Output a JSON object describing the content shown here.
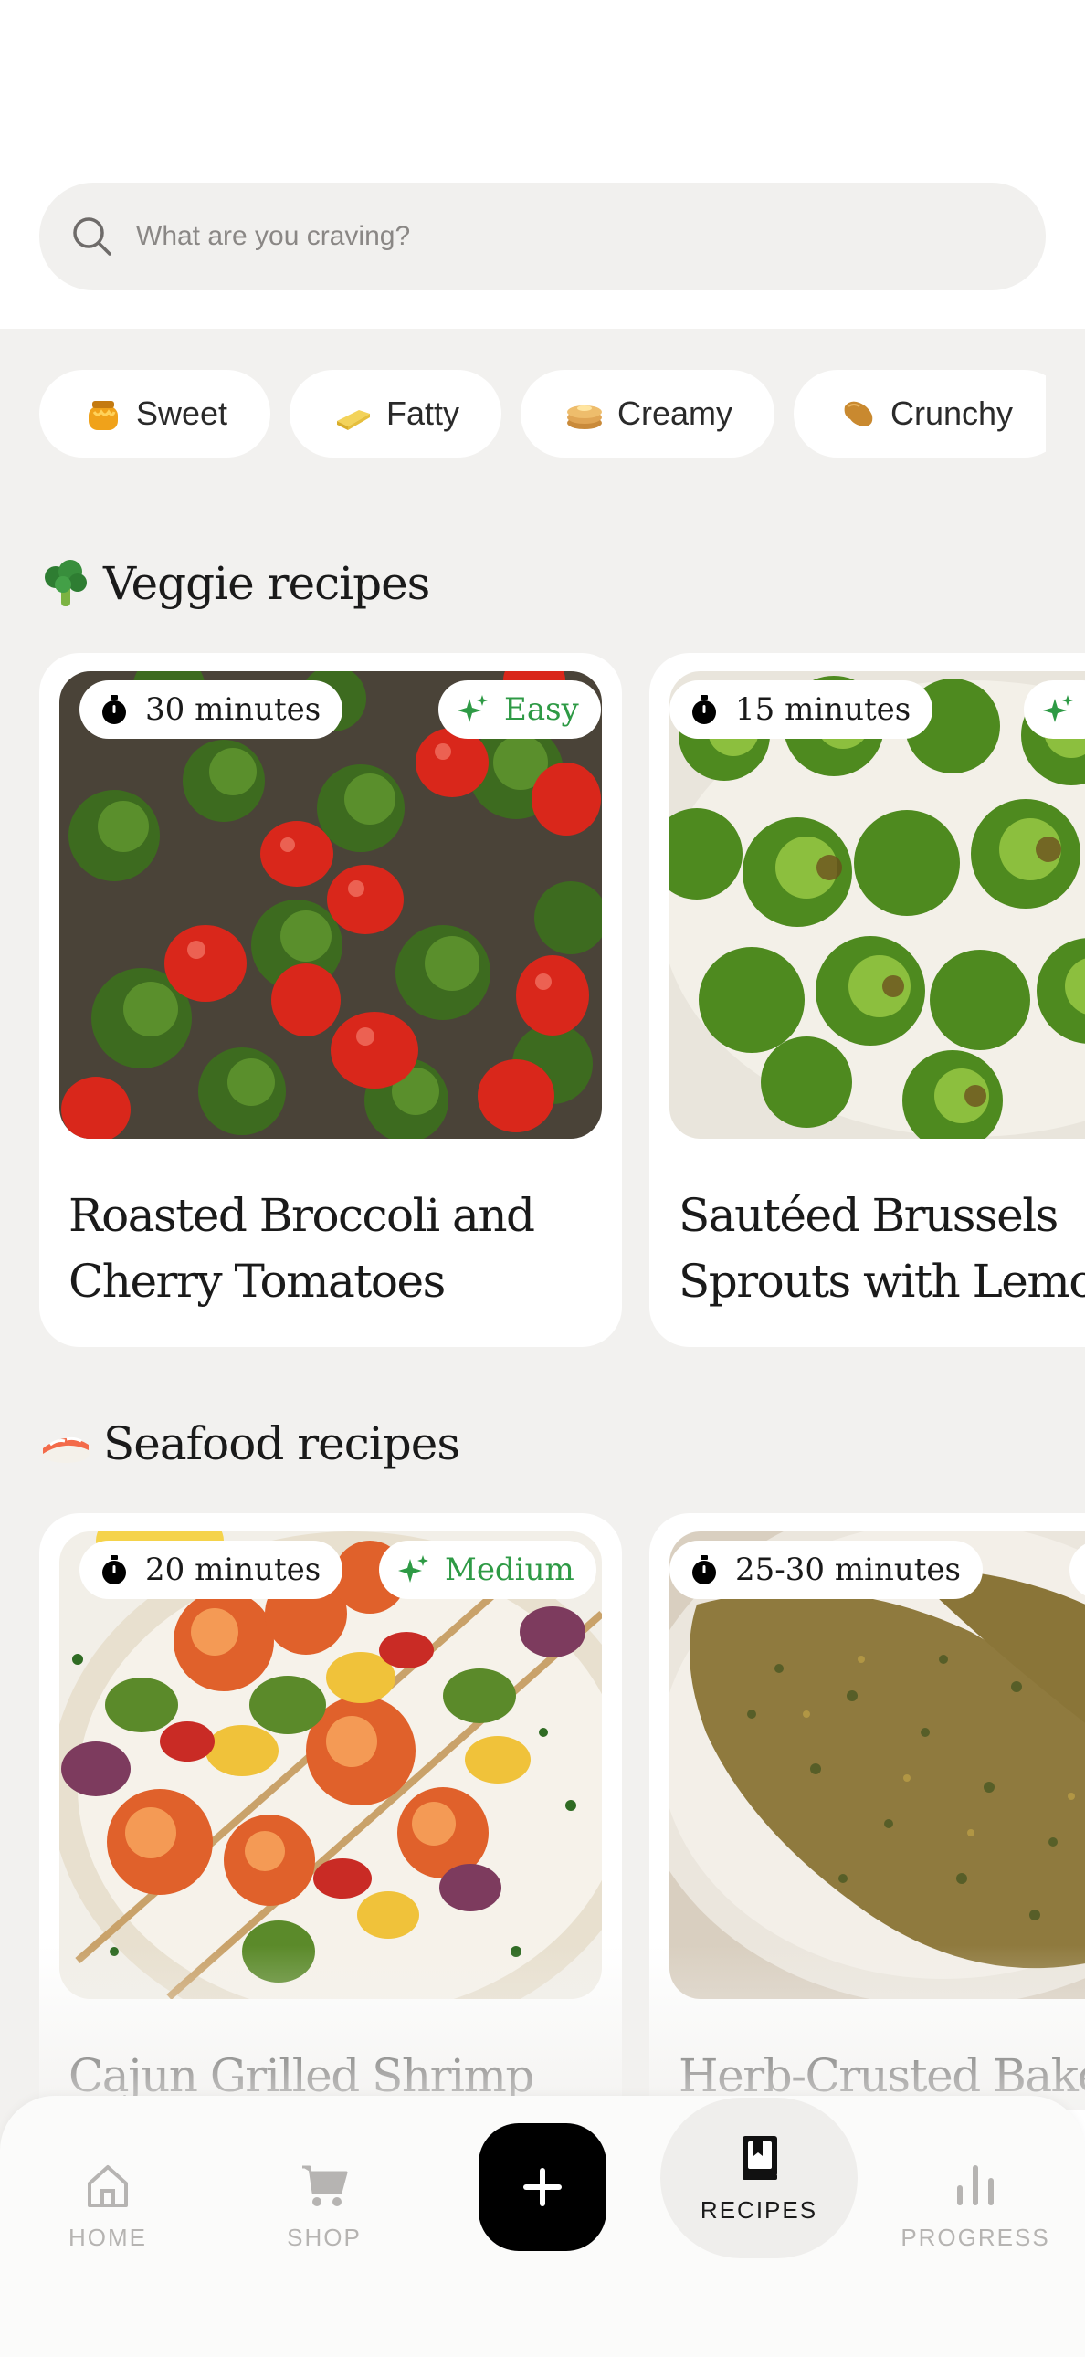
{
  "search": {
    "placeholder": "What are you craving?",
    "icon": "search-icon"
  },
  "filters": [
    {
      "label": "Sweet",
      "icon": "honey-pot-icon"
    },
    {
      "label": "Fatty",
      "icon": "butter-icon"
    },
    {
      "label": "Creamy",
      "icon": "pancakes-icon"
    },
    {
      "label": "Crunchy",
      "icon": "peanut-icon"
    }
  ],
  "sections": [
    {
      "title": "Veggie recipes",
      "icon": "broccoli-icon",
      "recipes": [
        {
          "time": "30 minutes",
          "level": "Easy",
          "name_line1": "Roasted Broccoli and",
          "name_line2": "Cherry Tomatoes"
        },
        {
          "time": "15 minutes",
          "level": "",
          "name_line1": "Sautéed Brussels",
          "name_line2": "Sprouts with Lemo"
        }
      ]
    },
    {
      "title": "Seafood recipes",
      "icon": "sushi-icon",
      "recipes": [
        {
          "time": "20 minutes",
          "level": "Medium",
          "name_line1": "Cajun Grilled Shrimp",
          "name_line2": ""
        },
        {
          "time": "25-30 minutes",
          "level": "",
          "name_line1": "Herb-Crusted Bake",
          "name_line2": ""
        }
      ]
    }
  ],
  "nav": {
    "home": "HOME",
    "shop": "SHOP",
    "add": "+",
    "recipes": "RECIPES",
    "progress": "PROGRESS",
    "active": "recipes"
  },
  "colors": {
    "accent_green": "#2e9a45",
    "background": "#f2f1ef",
    "add_button": "#000000"
  }
}
